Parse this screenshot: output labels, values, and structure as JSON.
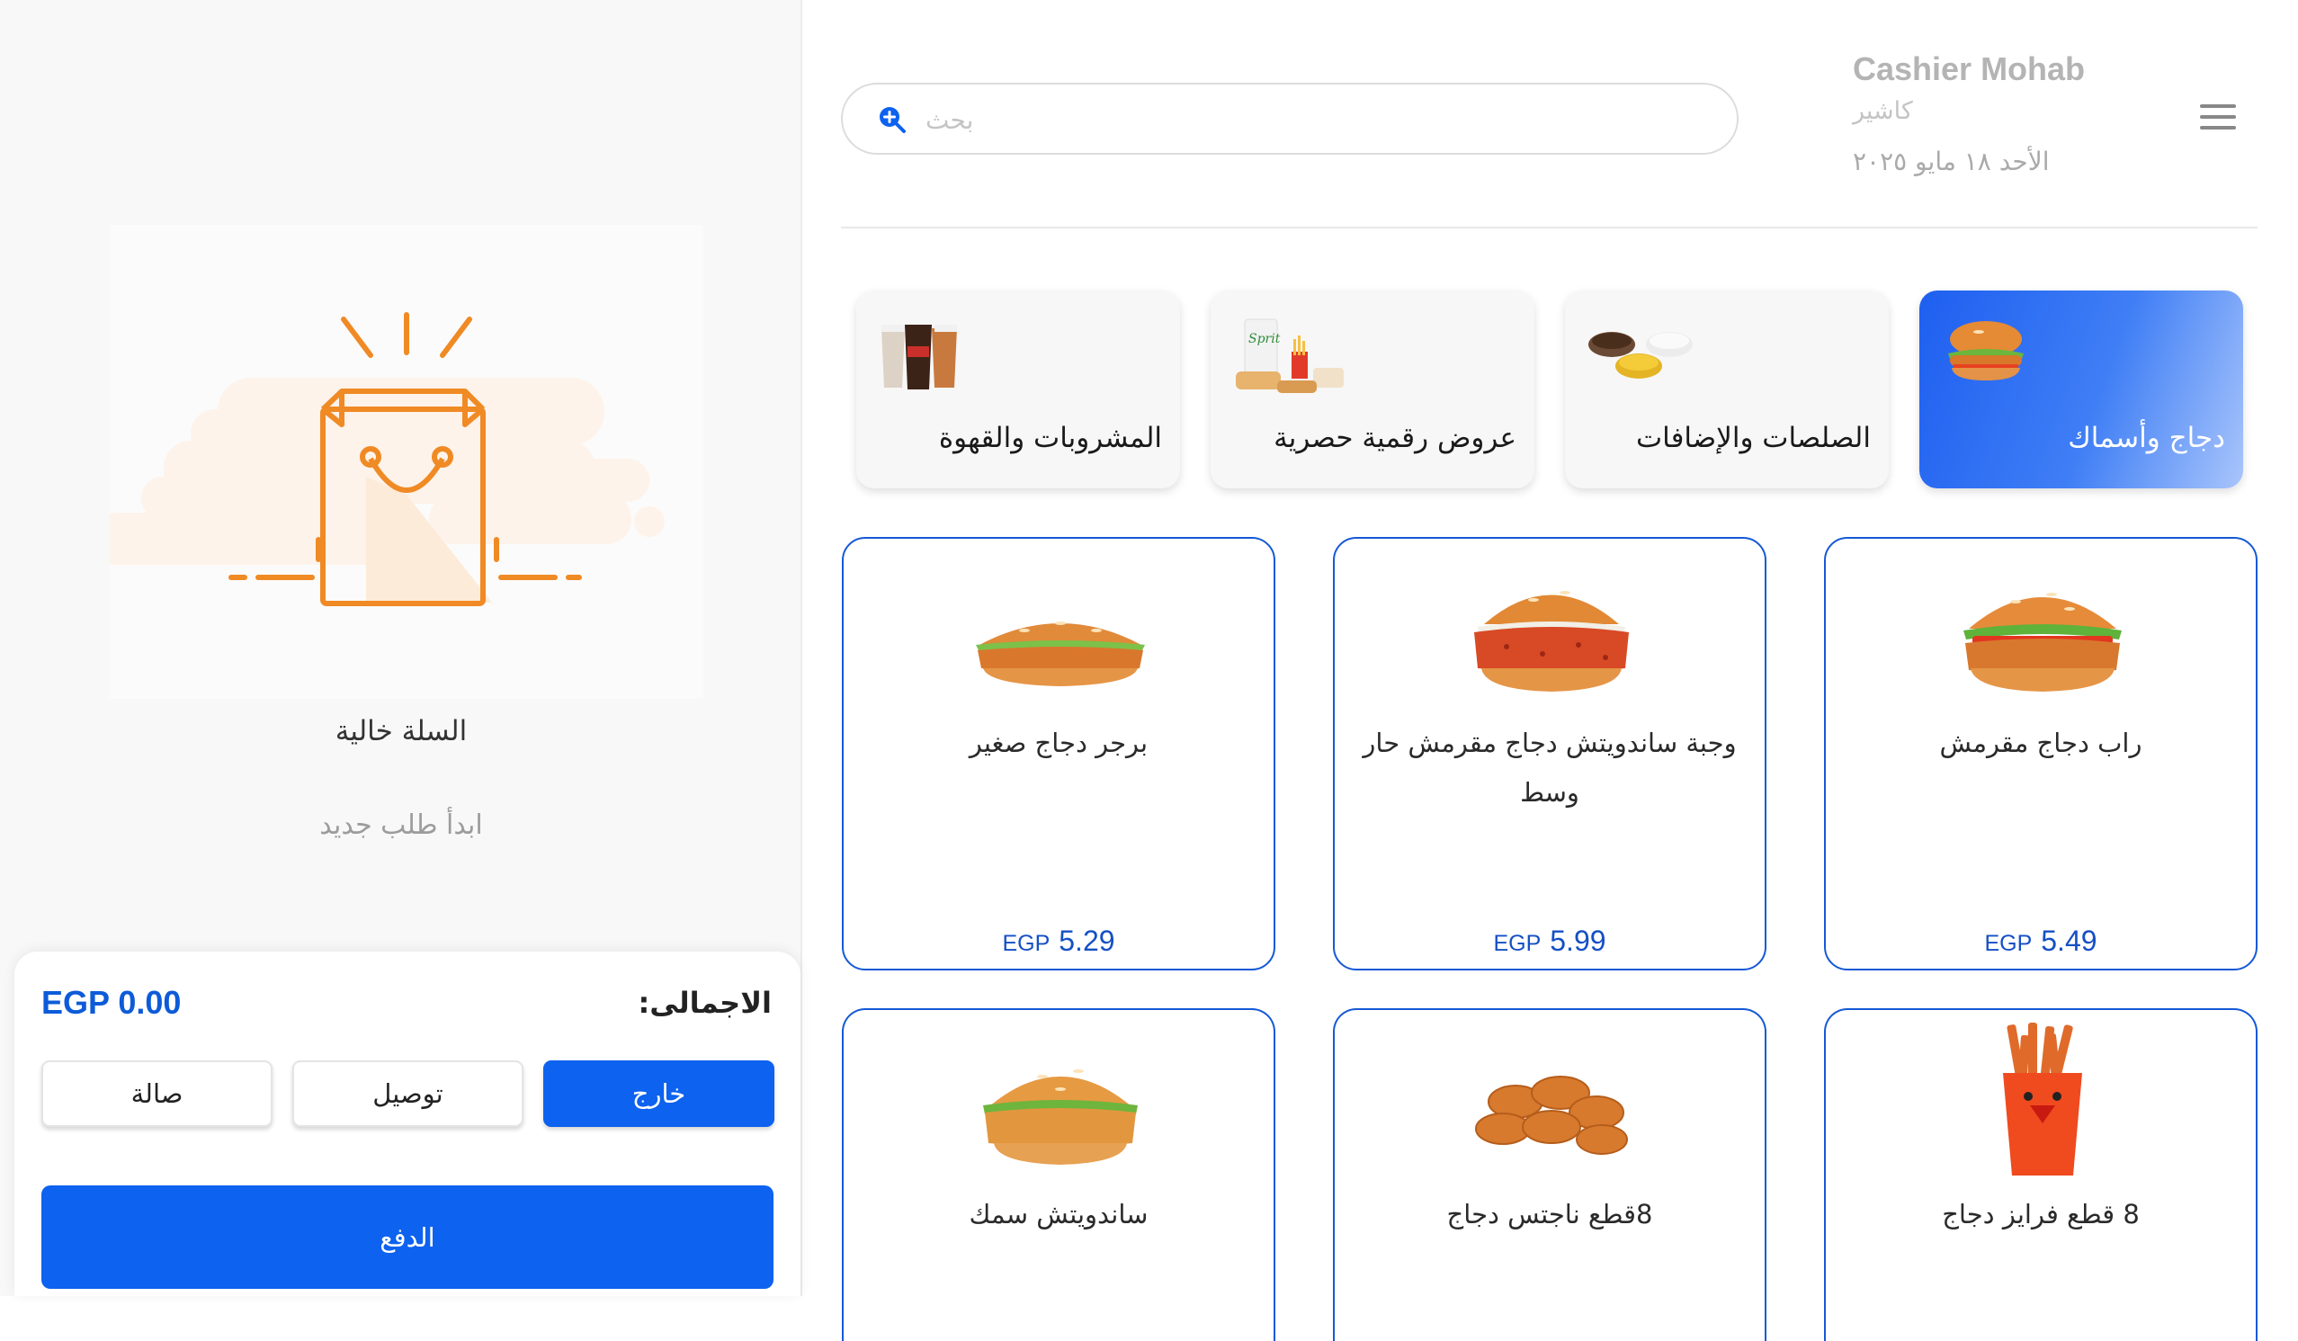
{
  "header": {
    "cashier_name": "Cashier Mohab",
    "cashier_role": "كاشير",
    "date": "الأحد ١٨ مايو ٢٠٢٥"
  },
  "search": {
    "placeholder": "بحث",
    "value": ""
  },
  "categories": [
    {
      "label": "دجاج وأسماك",
      "active": true,
      "icon": "chicken-burger-image"
    },
    {
      "label": "الصلصات والإضافات",
      "active": false,
      "icon": "sauces-image"
    },
    {
      "label": "عروض رقمية حصرية",
      "active": false,
      "icon": "combo-offer-image"
    },
    {
      "label": "المشروبات والقهوة",
      "active": false,
      "icon": "drinks-image"
    }
  ],
  "products": [
    {
      "name": "راب دجاج مقرمش",
      "currency": "EGP",
      "price": "5.49",
      "icon": "crispy-chicken-burger-image"
    },
    {
      "name": "وجبة ساندويتش دجاج مقرمش حار وسط",
      "currency": "EGP",
      "price": "5.99",
      "icon": "spicy-chicken-burger-image"
    },
    {
      "name": "برجر دجاج صغير",
      "currency": "EGP",
      "price": "5.29",
      "icon": "small-chicken-burger-image"
    },
    {
      "name": "8 قطع فرايز دجاج",
      "icon": "chicken-fries-image"
    },
    {
      "name": "8قطع ناجتس دجاج",
      "icon": "chicken-nuggets-image"
    },
    {
      "name": "ساندويتش سمك",
      "icon": "fish-sandwich-image"
    }
  ],
  "cart": {
    "empty_title": "السلة خالية",
    "empty_subtitle": "ابدأ طلب جديد",
    "illustration": "empty-shopping-bag-image",
    "total_label": "الاجمالى:",
    "total_value": "EGP 0.00",
    "order_types": [
      {
        "label": "خارج",
        "active": true
      },
      {
        "label": "توصيل",
        "active": false
      },
      {
        "label": "صالة",
        "active": false
      }
    ],
    "pay_label": "الدفع"
  },
  "colors": {
    "primary": "#0d62ef",
    "price": "#1550c4",
    "accent_orange": "#f08a24"
  }
}
